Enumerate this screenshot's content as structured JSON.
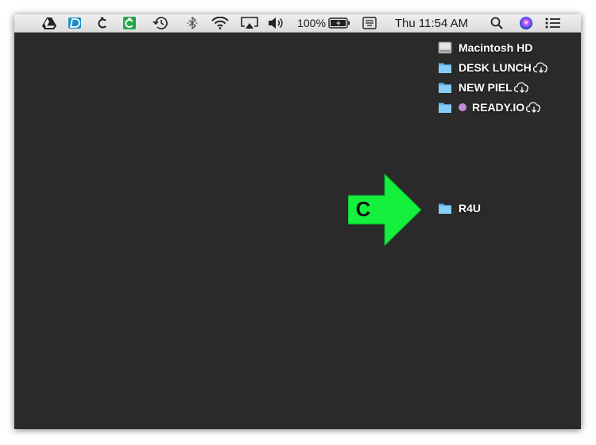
{
  "menubar": {
    "battery_percent": "100%",
    "clock": "Thu 11:54 AM",
    "icons": [
      "google-drive-icon",
      "dashlane-icon",
      "cleanmymac-icon",
      "cleanshot-icon",
      "time-machine-icon",
      "bluetooth-icon",
      "wifi-icon",
      "airplay-icon",
      "volume-icon",
      "battery-icon",
      "keyboard-icon",
      "spotlight-icon",
      "siri-icon",
      "notification-center-icon"
    ]
  },
  "desktop": {
    "items": [
      {
        "label": "Macintosh HD",
        "icon": "hard-drive-icon"
      },
      {
        "label": "DESK LUNCH",
        "icon": "folder-icon",
        "cloud": true
      },
      {
        "label": "NEW PIEL",
        "icon": "folder-icon",
        "cloud": true
      },
      {
        "label": "READY.IO",
        "icon": "folder-icon",
        "cloud": true,
        "tag_color": "#c58bd8"
      },
      {
        "label": "R4U",
        "icon": "folder-icon"
      }
    ]
  },
  "overlay": {
    "arrow_color": "#14f03c",
    "arrow_letter": "C"
  }
}
